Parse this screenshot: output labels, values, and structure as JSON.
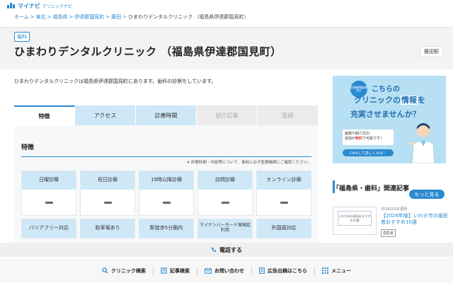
{
  "logo": {
    "text": "マイナビ",
    "sub": "クリニックナビ"
  },
  "breadcrumb": [
    {
      "label": "ホーム"
    },
    {
      "label": "東北"
    },
    {
      "label": "福島県"
    },
    {
      "label": "伊達郡国見町"
    },
    {
      "label": "藤田"
    },
    {
      "label": "ひまわりデンタルクリニック （福島県伊達郡国見町）"
    }
  ],
  "header": {
    "badge": "歯科",
    "title": "ひまわりデンタルクリニック （福島県伊達郡国見町）",
    "station": "藤田駅"
  },
  "description": "ひまわりデンタルクリニックは福島県伊達郡国見町にあります。歯科の診察をしています。",
  "tabs": [
    {
      "label": "特徴"
    },
    {
      "label": "アクセス"
    },
    {
      "label": "診療時間"
    },
    {
      "label": "紹介記事"
    },
    {
      "label": "医師"
    }
  ],
  "features": {
    "title": "特徴",
    "note": "※ 診療時間・内容等について、事前に必ず医療機関にご確認ください。",
    "items": [
      {
        "label": "日曜診療"
      },
      {
        "label": "祝日診療"
      },
      {
        "label": "19時以降診療"
      },
      {
        "label": "訪問診療"
      },
      {
        "label": "オンライン診療"
      },
      {
        "label": "バリアフリー対応"
      },
      {
        "label": "駐車場あり"
      },
      {
        "label": "駅徒歩5分圏内"
      },
      {
        "label": "マイナンバーカード保険証利用"
      },
      {
        "label": "外国語対応"
      }
    ]
  },
  "banner": {
    "tag": "医療機関者様向け",
    "line1": "こちらの",
    "line2a": "クリニックの",
    "line2b": "情報",
    "line2c": "を",
    "line3": "充実させませんか？",
    "box_text_a": "画像や紹介文の",
    "box_text_b": "追加が",
    "box_text_red": "無料",
    "box_text_c": "で可能です！",
    "button": "Clickして詳しくみる！"
  },
  "related": {
    "title": "「福島県・歯科」関連記事",
    "more": "もっと見る",
    "article": {
      "thumb_text": "いわき市の歯医者 おすすめ10選",
      "date": "2026/2/19 更新",
      "title": "【2026年版】いわき市の歯医者おすすめ10選",
      "badge": "歯医者"
    }
  },
  "bottom": {
    "phone": "電話する",
    "nav": [
      {
        "label": "クリニック検索",
        "icon": "search-icon"
      },
      {
        "label": "記事検索",
        "icon": "book-icon"
      },
      {
        "label": "お問い合わせ",
        "icon": "mail-icon"
      },
      {
        "label": "広告出稿はこちら",
        "icon": "document-icon"
      },
      {
        "label": "メニュー",
        "icon": "grid-icon"
      }
    ]
  }
}
